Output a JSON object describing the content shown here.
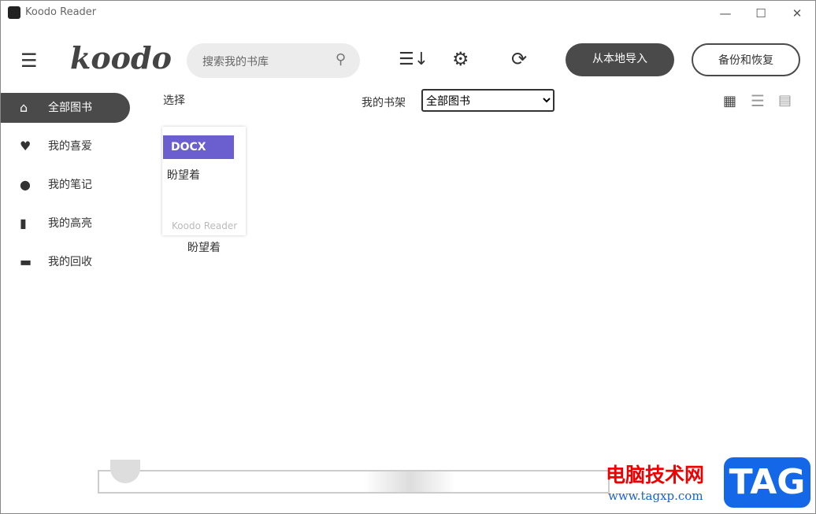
{
  "window": {
    "title": "Koodo Reader",
    "minimize": "—",
    "maximize": "☐",
    "close": "✕"
  },
  "header": {
    "logo": "koodo",
    "search_placeholder": "搜索我的书库",
    "import_label": "从本地导入",
    "backup_label": "备份和恢复"
  },
  "sidebar": {
    "items": [
      {
        "label": "全部图书",
        "icon": "home-icon"
      },
      {
        "label": "我的喜爱",
        "icon": "heart-icon"
      },
      {
        "label": "我的笔记",
        "icon": "bulb-icon"
      },
      {
        "label": "我的高亮",
        "icon": "notebook-icon"
      },
      {
        "label": "我的回收",
        "icon": "trash-icon"
      }
    ]
  },
  "toolbar": {
    "select_label": "选择",
    "shelf_label": "我的书架",
    "shelf_value": "全部图书"
  },
  "books": [
    {
      "format": "DOCX",
      "cover_title": "盼望着",
      "watermark": "Koodo Reader",
      "title": "盼望着"
    }
  ],
  "watermark": {
    "site_name": "电脑技术网",
    "url": "www.tagxp.com",
    "badge": "TAG"
  }
}
